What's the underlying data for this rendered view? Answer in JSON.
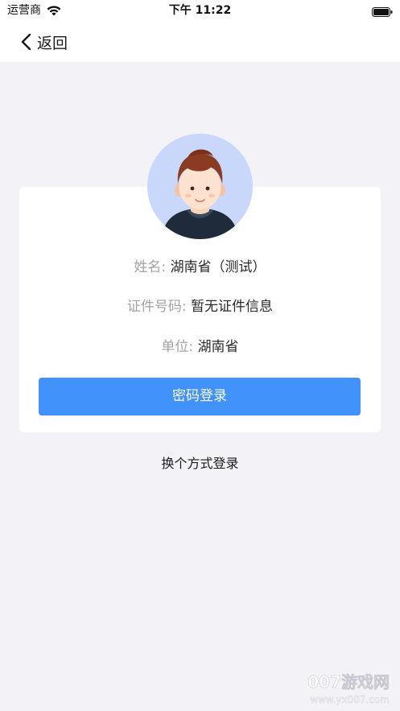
{
  "status_bar": {
    "carrier": "运营商",
    "time": "下午 11:22",
    "wifi_icon": "wifi-icon",
    "battery_icon": "battery-icon"
  },
  "nav": {
    "back_label": "返回",
    "back_icon": "chevron-left-icon"
  },
  "profile": {
    "avatar_icon": "avatar-illustration",
    "name_label": "姓名:",
    "name_value": "湖南省（测试）",
    "id_label": "证件号码:",
    "id_value": "暂无证件信息",
    "unit_label": "单位:",
    "unit_value": "湖南省"
  },
  "actions": {
    "password_login": "密码登录",
    "switch_login": "换个方式登录"
  },
  "watermark": {
    "text": "007游戏网",
    "url": "www.yx007.com"
  },
  "colors": {
    "primary_button": "#4193fb",
    "page_background": "#f3f3f7",
    "card_background": "#ffffff",
    "label_text": "#a2a2a8"
  }
}
